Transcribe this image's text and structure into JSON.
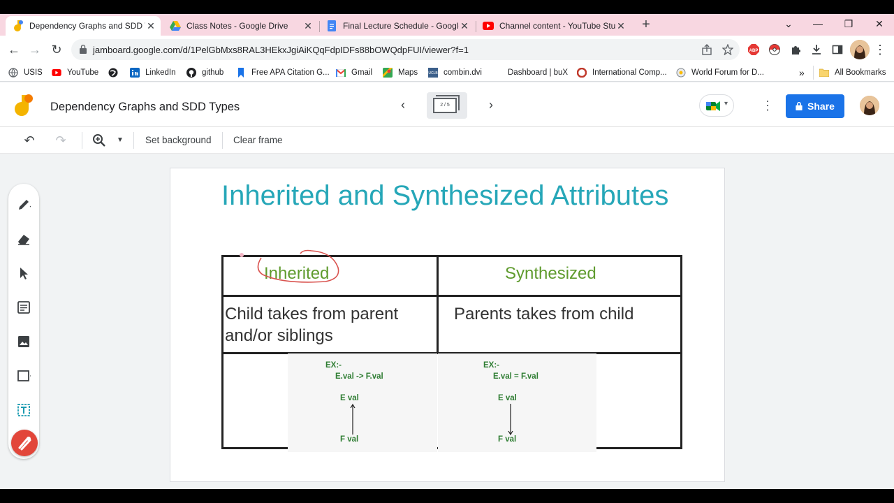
{
  "browser": {
    "tabs": [
      {
        "title": "Dependency Graphs and SDD Ty",
        "icon": "jamboard-icon",
        "active": true
      },
      {
        "title": "Class Notes - Google Drive",
        "icon": "google-drive-icon",
        "active": false
      },
      {
        "title": "Final Lecture Schedule - Google",
        "icon": "google-docs-icon",
        "active": false
      },
      {
        "title": "Channel content - YouTube Stud",
        "icon": "youtube-icon",
        "active": false
      }
    ],
    "close_glyph": "✕",
    "new_tab_glyph": "+",
    "url": "jamboard.google.com/d/1PelGbMxs8RAL3HEkxJgiAiKQqFdpIDFs88bOWQdpFUI/viewer?f=1",
    "bookmarks": [
      {
        "label": "USIS",
        "icon": "globe-icon"
      },
      {
        "label": "YouTube",
        "icon": "youtube-icon"
      },
      {
        "label": "",
        "icon": "web-icon"
      },
      {
        "label": "LinkedIn",
        "icon": "linkedin-icon"
      },
      {
        "label": "github",
        "icon": "github-icon"
      },
      {
        "label": "Free APA Citation G...",
        "icon": "bookmark-icon"
      },
      {
        "label": "Gmail",
        "icon": "gmail-icon"
      },
      {
        "label": "Maps",
        "icon": "maps-icon"
      },
      {
        "label": "combin.dvi",
        "icon": "pdf-icon"
      },
      {
        "label": "Dashboard | buX",
        "icon": "blank-icon"
      },
      {
        "label": "International Comp...",
        "icon": "site-icon"
      },
      {
        "label": "World Forum for D...",
        "icon": "site-icon"
      }
    ],
    "more_bookmarks": "»",
    "all_bookmarks": "All Bookmarks"
  },
  "jamboard": {
    "doc_title": "Dependency Graphs and SDD Types",
    "frame_indicator": "2 / 5",
    "share_label": "Share",
    "toolbar": {
      "set_background": "Set background",
      "clear_frame": "Clear frame"
    }
  },
  "slide": {
    "title": "Inherited and Synthesized Attributes",
    "headers": [
      "Inherited",
      "Synthesized"
    ],
    "row1": {
      "inherited_line1": "Child takes from parent",
      "inherited_line2": "and/or siblings",
      "synthesized": "Parents takes from child"
    },
    "examples": [
      {
        "ex": "EX:-",
        "rule": "E.val -> F.val",
        "top": "E  val",
        "bottom": "F  val",
        "arrow": "up"
      },
      {
        "ex": "EX:-",
        "rule": "E.val = F.val",
        "top": "E  val",
        "bottom": "F  val",
        "arrow": "down"
      }
    ]
  },
  "colors": {
    "title": "#26a7b8",
    "header_text": "#5f9b2e",
    "share_button": "#1a73e8",
    "ink_annotation": "#d9534f",
    "laser": "#e2463a"
  }
}
